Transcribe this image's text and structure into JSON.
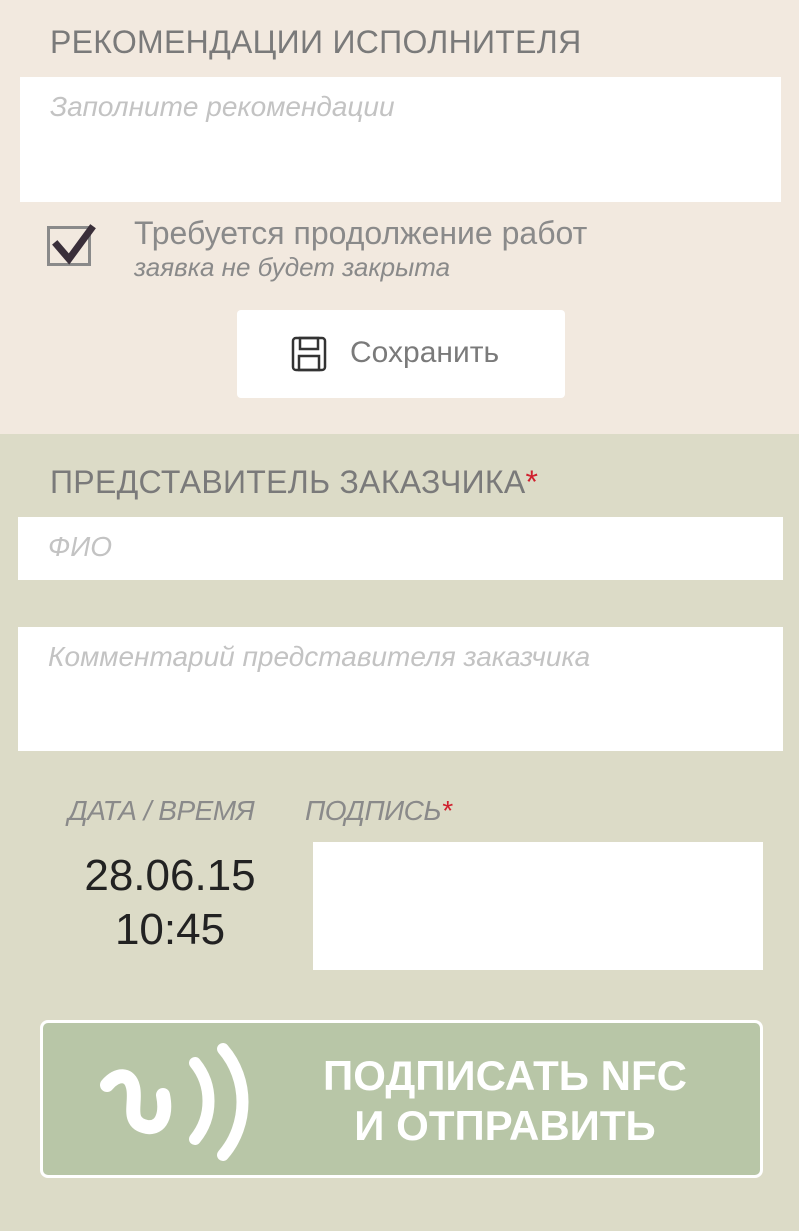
{
  "executor": {
    "heading": "РЕКОМЕНДАЦИИ ИСПОЛНИТЕЛЯ",
    "recommendations_placeholder": "Заполните рекомендации",
    "recommendations_value": "",
    "continue_work": {
      "checked": true,
      "label": "Требуется продолжение работ",
      "sublabel": "заявка не будет закрыта"
    },
    "save_label": "Сохранить",
    "save_icon": "floppy-disk-icon"
  },
  "customer": {
    "heading": "ПРЕДСТАВИТЕЛЬ ЗАКАЗЧИКА",
    "required_mark": "*",
    "name_placeholder": "ФИО",
    "name_value": "",
    "comment_placeholder": "Комментарий представителя заказчика",
    "comment_value": "",
    "datetime_label": "ДАТА / ВРЕМЯ",
    "signature_label": "ПОДПИСЬ",
    "date": "28.06.15",
    "time": "10:45"
  },
  "nfc_button": {
    "line1": "ПОДПИСАТЬ NFC",
    "line2": "И ОТПРАВИТЬ",
    "icon": "nfc-icon"
  },
  "colors": {
    "top_background": "#f2e9df",
    "bottom_background": "#dcdbc7",
    "nfc_button": "#b8c6a7",
    "required": "#d0202e"
  }
}
